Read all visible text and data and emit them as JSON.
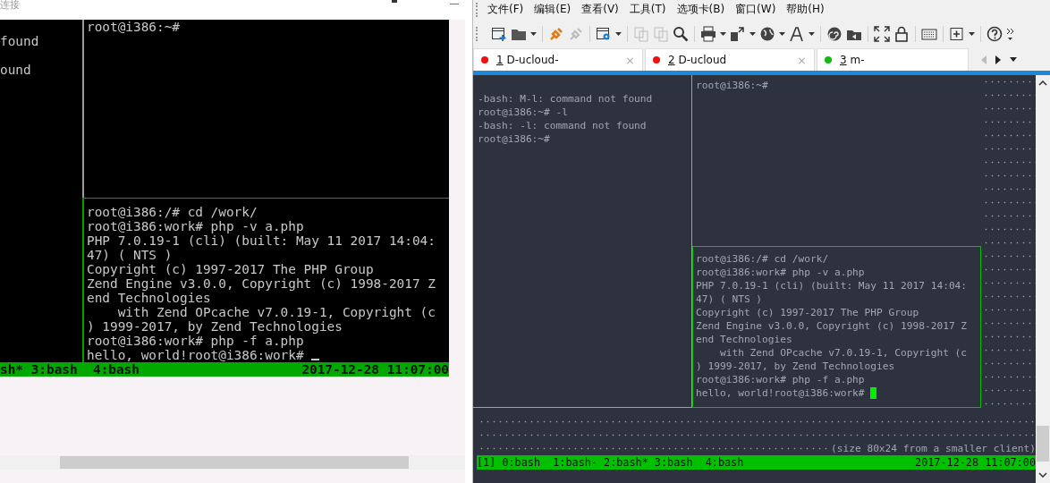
{
  "left_window": {
    "title": "连接",
    "terminal": {
      "left_pane": [
        "found",
        "ound"
      ],
      "top_pane": [
        "root@i386:~#"
      ],
      "bottom_pane": [
        "root@i386:/# cd /work/",
        "root@i386:work# php -v a.php",
        "PHP 7.0.19-1 (cli) (built: May 11 2017 14:04:",
        "47) ( NTS )",
        "Copyright (c) 1997-2017 The PHP Group",
        "Zend Engine v3.0.0, Copyright (c) 1998-2017 Z",
        "end Technologies",
        "    with Zend OPcache v7.0.19-1, Copyright (c",
        ") 1999-2017, by Zend Technologies",
        "root@i386:work# php -f a.php",
        "hello, world!root@i386:work# "
      ]
    },
    "status_bar": {
      "windows": "sh* 3:bash  4:bash",
      "clock": "2017-12-28 11:07:00"
    }
  },
  "right_window": {
    "menu": [
      "文件(F)",
      "编辑(E)",
      "查看(V)",
      "工具(T)",
      "选项卡(B)",
      "窗口(W)",
      "帮助(H)"
    ],
    "tabs": [
      {
        "number": "1",
        "title": "D-ucloud-",
        "color": "#ee1111",
        "close": "×"
      },
      {
        "number": "2",
        "title": "D-ucloud",
        "color": "#ee1111",
        "close": "×"
      },
      {
        "number": "3",
        "title": "m-",
        "color": "#11bb11"
      }
    ],
    "terminal": {
      "left_pane": [
        "-bash: M-l: command not found",
        "root@i386:~# -l",
        "-bash: -l: command not found",
        "root@i386:~#"
      ],
      "top_pane": [
        "root@i386:~#"
      ],
      "bottom_pane": [
        "root@i386:/# cd /work/",
        "root@i386:work# php -v a.php",
        "PHP 7.0.19-1 (cli) (built: May 11 2017 14:04:",
        "47) ( NTS )",
        "Copyright (c) 1997-2017 The PHP Group",
        "Zend Engine v3.0.0, Copyright (c) 1998-2017 Z",
        "end Technologies",
        "    with Zend OPcache v7.0.19-1, Copyright (c",
        ") 1999-2017, by Zend Technologies",
        "root@i386:work# php -f a.php",
        "hello, world!root@i386:work# "
      ],
      "notice": "(size 80x24 from a smaller client)"
    },
    "status_bar": {
      "windows": "[1] 0:bash  1:bash- 2:bash* 3:bash  4:bash",
      "clock": "2017-12-28 11:07:00"
    }
  }
}
